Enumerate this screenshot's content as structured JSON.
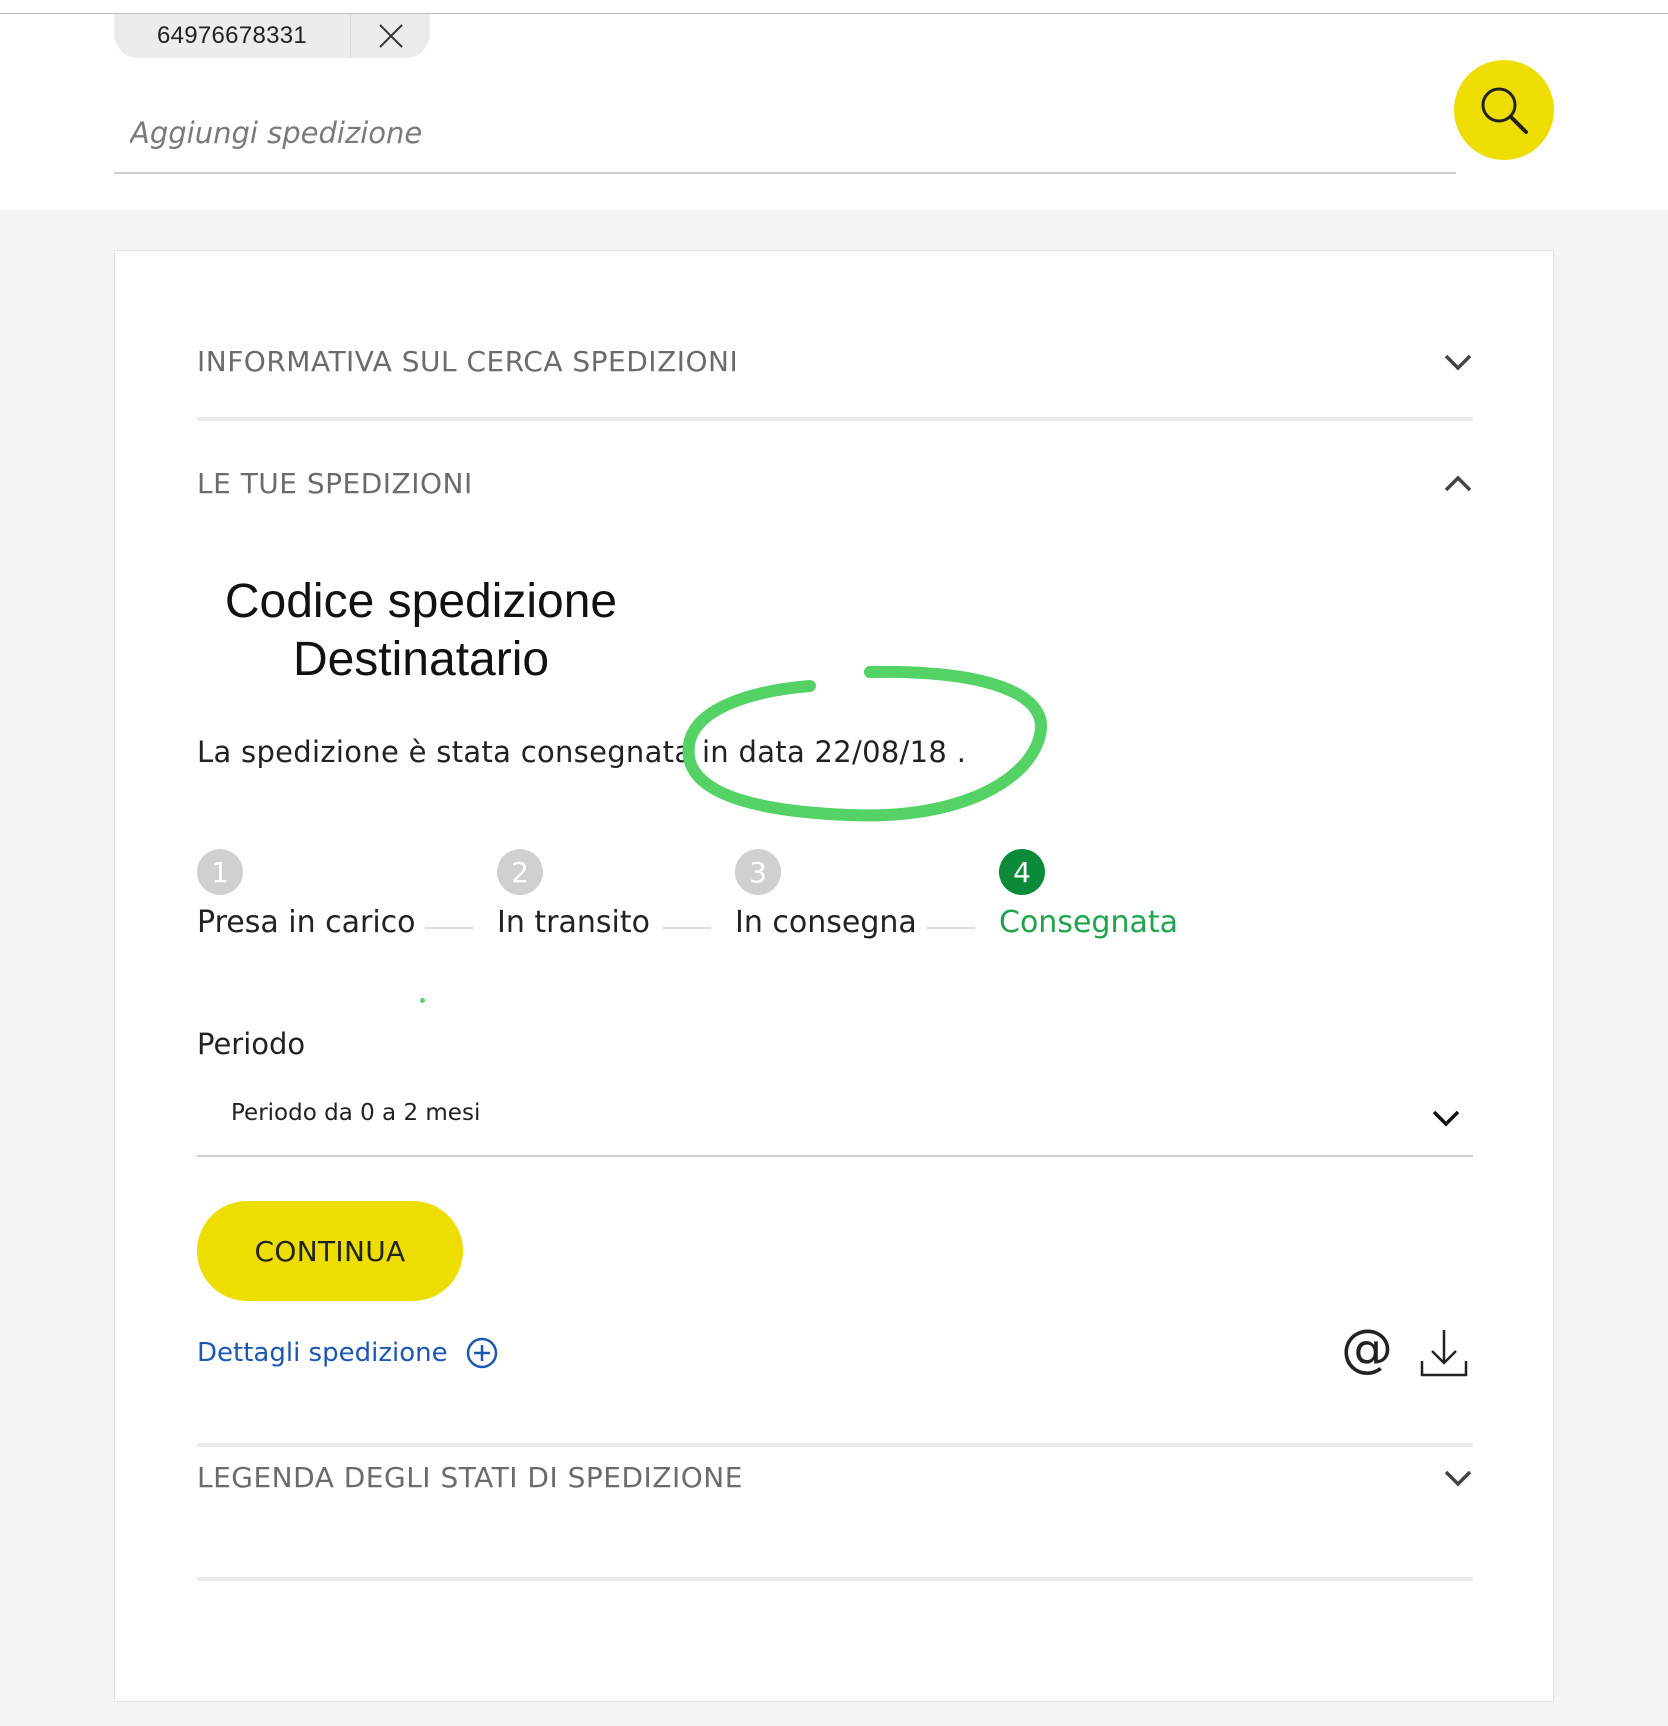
{
  "header": {
    "chip_code": "64976678331",
    "search_placeholder": "Aggiungi spedizione"
  },
  "accordions": {
    "informativa": "INFORMATIVA SUL CERCA SPEDIZIONI",
    "tue_spedizioni": "LE TUE SPEDIZIONI",
    "legenda": "LEGENDA DEGLI STATI DI SPEDIZIONE"
  },
  "shipment": {
    "code_line1": "Codice spedizione",
    "code_line2": "Destinatario",
    "status_text": "La spedizione è stata consegnata in data 22/08/18 ."
  },
  "steps": [
    {
      "number": "1",
      "label": "Presa in carico",
      "active": false
    },
    {
      "number": "2",
      "label": "In transito",
      "active": false
    },
    {
      "number": "3",
      "label": "In consegna",
      "active": false
    },
    {
      "number": "4",
      "label": "Consegnata",
      "active": true
    }
  ],
  "periodo": {
    "label": "Periodo",
    "selected": "Periodo da 0 a 2 mesi"
  },
  "actions": {
    "continua": "CONTINUA",
    "dettagli": "Dettagli spedizione",
    "email_symbol": "@"
  },
  "icons": [
    "close-icon",
    "search-icon",
    "chevron-down-icon",
    "chevron-up-icon",
    "plus-circle-icon",
    "at-icon",
    "download-icon"
  ],
  "colors": {
    "accent_yellow": "#eedd00",
    "active_green": "#0b8a3a",
    "active_label_green": "#1ea54c",
    "link_blue": "#1c57b4",
    "annotation_green": "#55d266"
  }
}
